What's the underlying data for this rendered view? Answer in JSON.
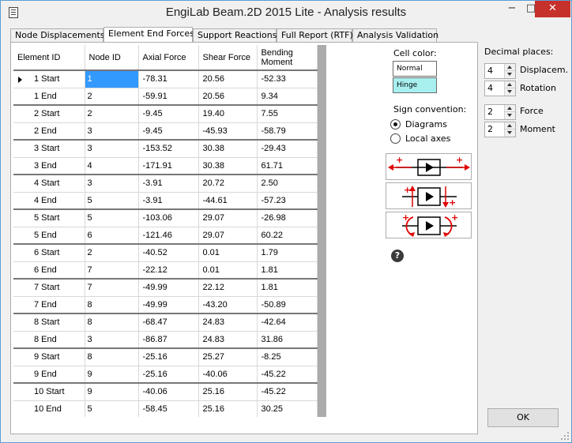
{
  "window": {
    "title": "EngiLab Beam.2D 2015 Lite - Analysis results",
    "min_glyph": "−",
    "max_glyph": "□",
    "close_glyph": "✕"
  },
  "tabs": [
    "Node Displacements",
    "Element End Forces",
    "Support Reactions",
    "Full Report (RTF)",
    "Analysis Validation"
  ],
  "grid": {
    "columns": [
      "Element ID",
      "Node ID",
      "Axial Force",
      "Shear Force",
      "Bending Moment"
    ],
    "rows": [
      [
        "1 Start",
        "1",
        "-78.31",
        "20.56",
        "-52.33"
      ],
      [
        "1 End",
        "2",
        "-59.91",
        "20.56",
        "9.34"
      ],
      [
        "2 Start",
        "2",
        "-9.45",
        "19.40",
        "7.55"
      ],
      [
        "2 End",
        "3",
        "-9.45",
        "-45.93",
        "-58.79"
      ],
      [
        "3 Start",
        "3",
        "-153.52",
        "30.38",
        "-29.43"
      ],
      [
        "3 End",
        "4",
        "-171.91",
        "30.38",
        "61.71"
      ],
      [
        "4 Start",
        "3",
        "-3.91",
        "20.72",
        "2.50"
      ],
      [
        "4 End",
        "5",
        "-3.91",
        "-44.61",
        "-57.23"
      ],
      [
        "5 Start",
        "5",
        "-103.06",
        "29.07",
        "-26.98"
      ],
      [
        "5 End",
        "6",
        "-121.46",
        "29.07",
        "60.22"
      ],
      [
        "6 Start",
        "2",
        "-40.52",
        "0.01",
        "1.79"
      ],
      [
        "6 End",
        "7",
        "-22.12",
        "0.01",
        "1.81"
      ],
      [
        "7 Start",
        "7",
        "-49.99",
        "22.12",
        "1.81"
      ],
      [
        "7 End",
        "8",
        "-49.99",
        "-43.20",
        "-50.89"
      ],
      [
        "8 Start",
        "8",
        "-68.47",
        "24.83",
        "-42.64"
      ],
      [
        "8 End",
        "3",
        "-86.87",
        "24.83",
        "31.86"
      ],
      [
        "9 Start",
        "8",
        "-25.16",
        "25.27",
        "-8.25"
      ],
      [
        "9 End",
        "9",
        "-25.16",
        "-40.06",
        "-45.22"
      ],
      [
        "10 Start",
        "9",
        "-40.06",
        "25.16",
        "-45.22"
      ],
      [
        "10 End",
        "5",
        "-58.45",
        "25.16",
        "30.25"
      ]
    ]
  },
  "cell_color": {
    "label": "Cell color:",
    "normal": "Normal",
    "hinge": "Hinge",
    "hinge_color": "#a8f0f0"
  },
  "sign_convention": {
    "label": "Sign convention:",
    "diagrams": "Diagrams",
    "local_axes": "Local axes",
    "selected": "diagrams"
  },
  "help": {
    "glyph": "?"
  },
  "decimal_places": {
    "label": "Decimal places:",
    "items": [
      {
        "name": "Displacem.",
        "value": "4"
      },
      {
        "name": "Rotation",
        "value": "4"
      },
      {
        "name": "Force",
        "value": "2"
      },
      {
        "name": "Moment",
        "value": "2"
      }
    ]
  },
  "ok_label": "OK",
  "colors": {
    "accent": "#3399ff",
    "close": "#c7312b",
    "arrow": "#e00000"
  }
}
